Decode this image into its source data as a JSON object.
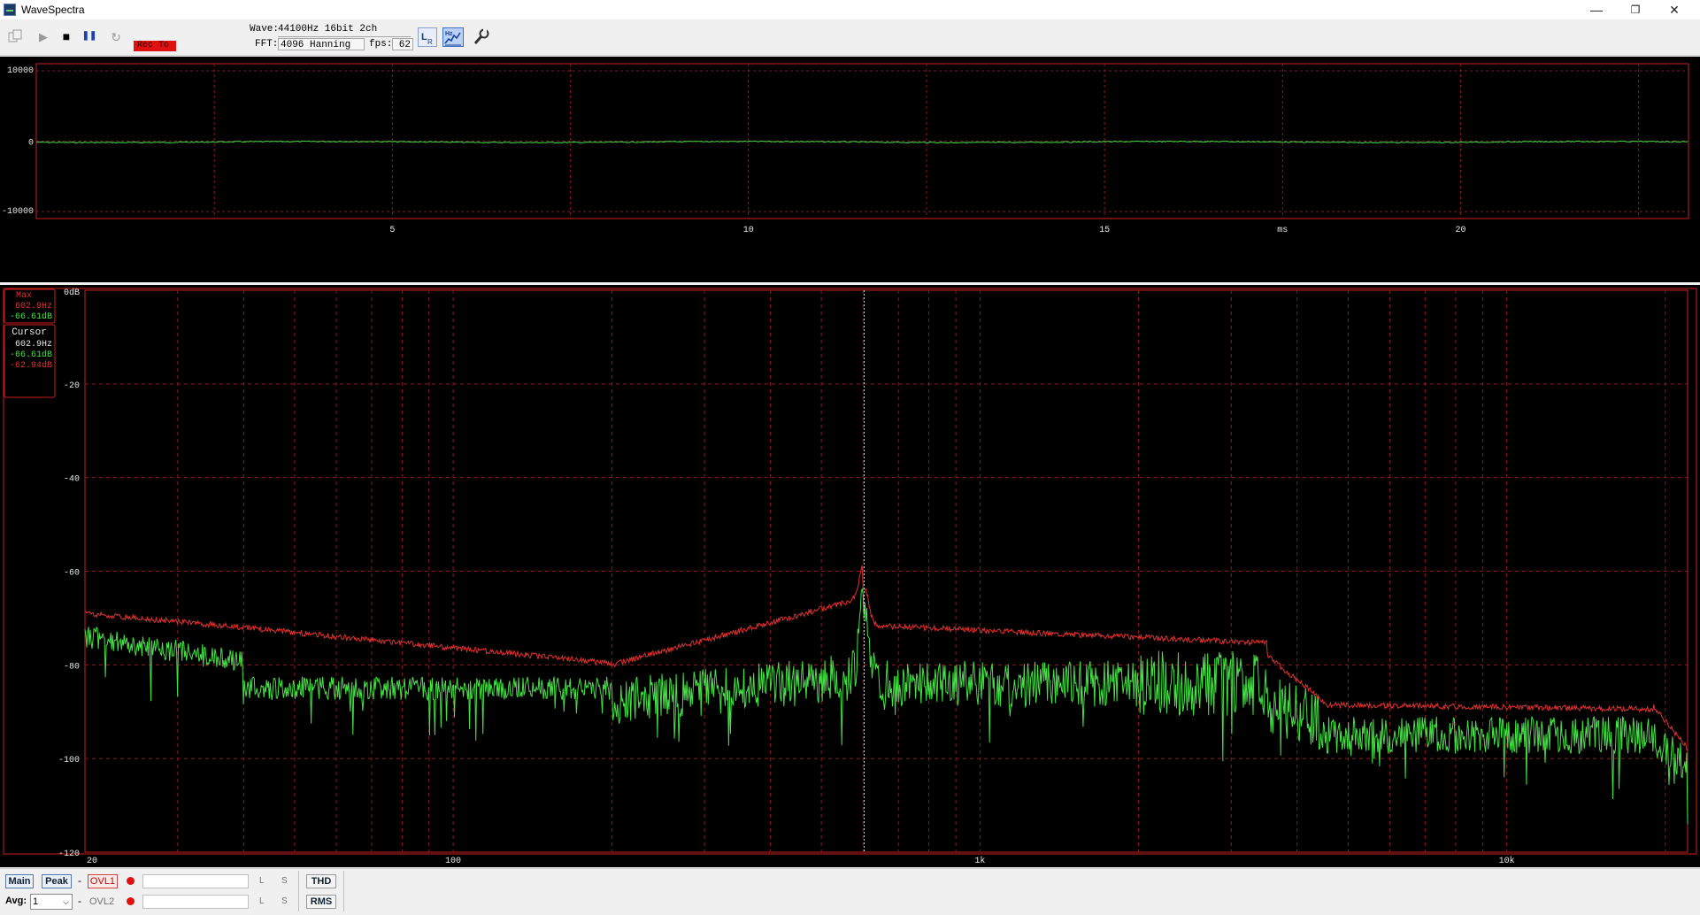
{
  "window": {
    "title": "WaveSpectra",
    "minimize": "—",
    "restore": "❐",
    "close": "✕"
  },
  "toolbar": {
    "rec_to_label": "Rec To",
    "wave_label": "Wave:",
    "wave_value": "44100Hz 16bit 2ch",
    "fft_label": "FFT:",
    "fft_value": "4096 Hanning",
    "fps_label": "fps:",
    "fps_value": "62",
    "stop_icon": "■",
    "pause_icon": "❚❚",
    "play_icon": "▶",
    "loop_icon": "↻"
  },
  "wave_panel": {
    "y_ticks": [
      "10000",
      "0",
      "-10000"
    ],
    "x_ticks": [
      "5",
      "10",
      "15",
      "20"
    ],
    "x_unit": "ms"
  },
  "spectrum_panel": {
    "y_ticks": [
      "0dB",
      "-20",
      "-40",
      "-60",
      "-80",
      "-100",
      "-120"
    ],
    "x_ticks": [
      "20",
      "100",
      "1k",
      "10k"
    ],
    "max_box": {
      "title": "Max",
      "freq": "602.9Hz",
      "level": "-66.61dB"
    },
    "cursor_box": {
      "title": "Cursor",
      "freq": "602.9Hz",
      "level_l": "-66.61dB",
      "level_r": "-62.94dB"
    },
    "cursor_freq_hz": 602.9,
    "colors": {
      "left": "#44e044",
      "right": "#e03030",
      "grid": "#8a1a1a",
      "frame": "#c82020"
    }
  },
  "bottombar": {
    "main_button": "Main",
    "peak_button": "Peak",
    "dash": "-",
    "ovl1_label": "OVL1",
    "ovl2_label": "OVL2",
    "l_label": "L",
    "s_label": "S",
    "thd_button": "THD",
    "rms_button": "RMS",
    "avg_label": "Avg:",
    "avg_value": "1"
  }
}
